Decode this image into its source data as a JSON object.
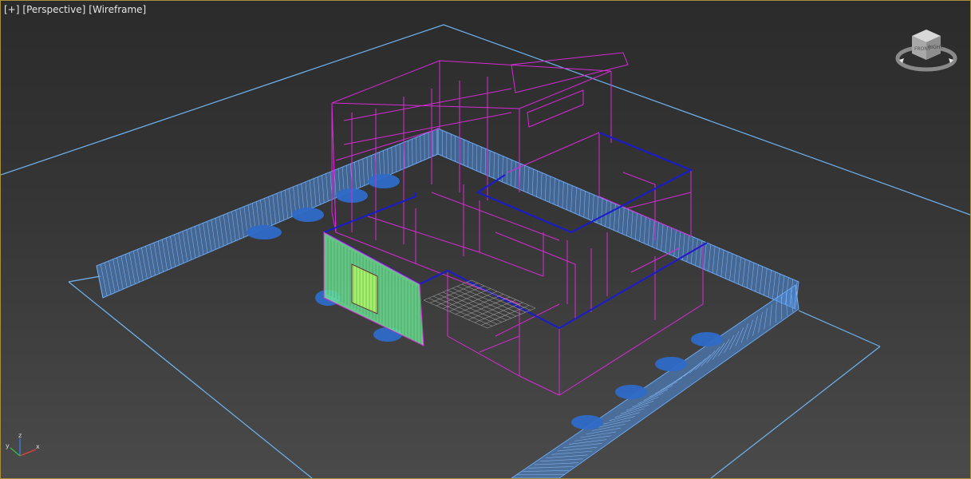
{
  "viewport": {
    "labels": {
      "menu": "[+]",
      "view": "[Perspective]",
      "shading": "[Wireframe]"
    },
    "colors": {
      "border": "#a98f3a",
      "ground_outline": "#6fb4f0",
      "wall_wire": "#6aa6f0",
      "building_wire": "#d62ad6",
      "selected_edges": "#1a1ad0",
      "facade": "#7ff0a0",
      "door": "#a6f06a",
      "shrub": "#2f6bc8",
      "floor_grid": "#9a9a9a"
    }
  },
  "viewcube": {
    "icon": "viewcube-icon",
    "label_front": "FRONT",
    "label_right": "RIGHT"
  },
  "axis_tripod": {
    "icon": "world-axis-icon",
    "x_label": "x",
    "y_label": "y",
    "z_label": "z"
  }
}
